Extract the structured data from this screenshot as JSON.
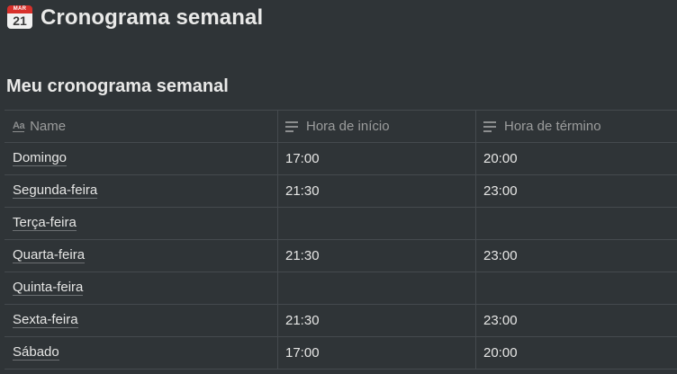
{
  "page": {
    "icon_month": "MAR",
    "icon_day": "21",
    "title": "Cronograma semanal"
  },
  "database": {
    "title": "Meu cronograma semanal",
    "columns": [
      {
        "label": "Name",
        "icon": "text-type-icon"
      },
      {
        "label": "Hora de início",
        "icon": "text-lines-icon"
      },
      {
        "label": "Hora de término",
        "icon": "text-lines-icon"
      }
    ],
    "rows": [
      {
        "name": "Domingo",
        "start": "17:00",
        "end": "20:00"
      },
      {
        "name": "Segunda-feira",
        "start": "21:30",
        "end": "23:00"
      },
      {
        "name": "Terça-feira",
        "start": "",
        "end": ""
      },
      {
        "name": "Quarta-feira",
        "start": "21:30",
        "end": "23:00"
      },
      {
        "name": "Quinta-feira",
        "start": "",
        "end": ""
      },
      {
        "name": "Sexta-feira",
        "start": "21:30",
        "end": "23:00"
      },
      {
        "name": "Sábado",
        "start": "17:00",
        "end": "20:00"
      }
    ]
  }
}
